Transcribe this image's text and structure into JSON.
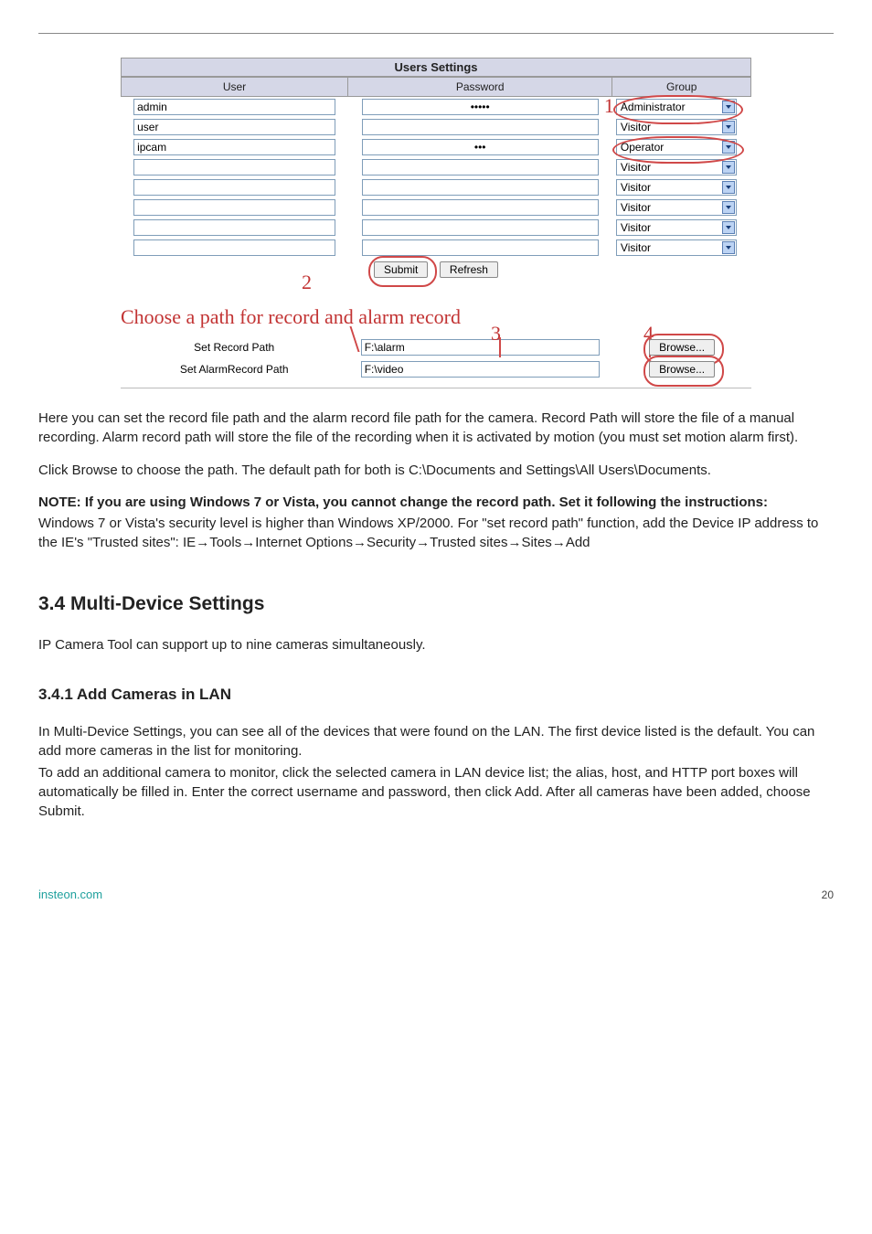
{
  "users_settings": {
    "title": "Users Settings",
    "columns": {
      "user": "User",
      "password": "Password",
      "group": "Group"
    },
    "rows": [
      {
        "user": "admin",
        "password": "•••••",
        "group": "Administrator"
      },
      {
        "user": "user",
        "password": "",
        "group": "Visitor"
      },
      {
        "user": "ipcam",
        "password": "•••",
        "group": "Operator"
      },
      {
        "user": "",
        "password": "",
        "group": "Visitor"
      },
      {
        "user": "",
        "password": "",
        "group": "Visitor"
      },
      {
        "user": "",
        "password": "",
        "group": "Visitor"
      },
      {
        "user": "",
        "password": "",
        "group": "Visitor"
      },
      {
        "user": "",
        "password": "",
        "group": "Visitor"
      }
    ],
    "buttons": {
      "submit": "Submit",
      "refresh": "Refresh"
    },
    "callouts": {
      "one": "1",
      "two": "2"
    }
  },
  "record_paths": {
    "heading": "Choose a path for record and alarm record",
    "callouts": {
      "three": "3",
      "four": "4"
    },
    "rows": [
      {
        "label": "Set Record Path",
        "value": "F:\\alarm",
        "btn": "Browse..."
      },
      {
        "label": "Set AlarmRecord Path",
        "value": "F:\\video",
        "btn": "Browse..."
      }
    ]
  },
  "body": {
    "p1": "Here you can set the record file path and the alarm record file path for the camera. Record Path will store the file of a manual recording. Alarm record path will store the file of the recording when it is activated by motion (you must set motion alarm first).",
    "p2": "Click Browse to choose the path. The default path for both is C:\\Documents and Settings\\All Users\\Documents.",
    "note_bold": "NOTE: If you are using Windows 7 or Vista, you cannot change the record path. Set it following the instructions:",
    "note_p_a": "Windows 7 or Vista's security level is higher than Windows XP/2000. For \"set record path\" function, add the Device IP address to the IE's \"Trusted sites\": IE",
    "note_chain": [
      "Tools",
      "Internet Options",
      "Security",
      "Trusted sites",
      "Sites",
      "Add"
    ],
    "arrow": "→",
    "h2": "3.4 Multi-Device Settings",
    "p3": "IP Camera Tool can support up to nine cameras simultaneously.",
    "h3": "3.4.1 Add Cameras in LAN",
    "p4": "In Multi-Device Settings, you can see all of the devices that were found on the LAN. The first device listed is the default. You can add more cameras in the list for monitoring.",
    "p5": "To add an additional camera to monitor, click the selected camera in LAN device list; the alias, host, and HTTP port boxes will automatically be filled in. Enter the correct username and password, then click Add. After all cameras have been added, choose Submit."
  },
  "footer": {
    "link": "insteon.com",
    "page": "20"
  }
}
